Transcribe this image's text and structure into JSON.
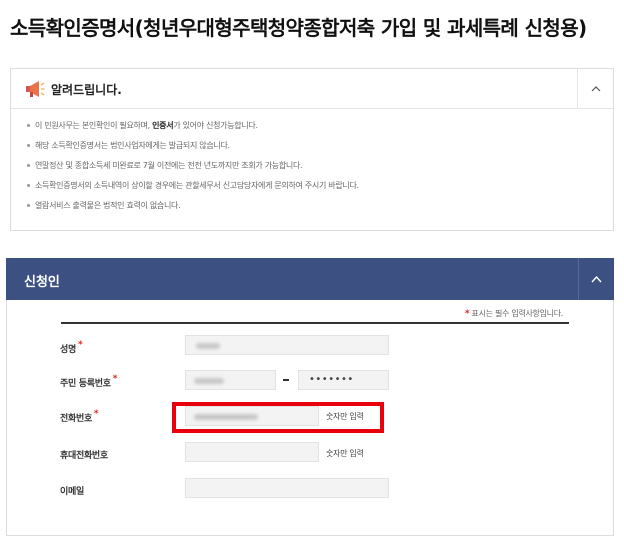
{
  "page": {
    "title": "소득확인증명서(청년우대형주택청약종합저축 가입 및 과세특례 신청용)"
  },
  "notice": {
    "title": "알려드립니다.",
    "items": [
      {
        "before": "이 민원사무는 본인확인이 필요하며, ",
        "bold": "인증서",
        "after": "가 있어야 신청가능합니다."
      },
      {
        "before": "해당 소득확인증명서는 법인사업자에게는 발급되지 않습니다.",
        "bold": "",
        "after": ""
      },
      {
        "before": "연말정산 및 종합소득세 미완료로 7월 이전에는 전전 년도까지만 조회가 가능합니다.",
        "bold": "",
        "after": ""
      },
      {
        "before": "소득확인증명서의 소득내역이 상이할 경우에는 관할세무서 신고담당자에게 문의하여 주시기 바랍니다.",
        "bold": "",
        "after": ""
      },
      {
        "before": "열람서비스 출력물은 법적인 효력이 없습니다.",
        "bold": "",
        "after": ""
      }
    ]
  },
  "applicant": {
    "title": "신청인",
    "required_note": "표시는 필수 입력사항입니다.",
    "required_mark": "*",
    "fields": {
      "name_label": "성명",
      "rrn_label": "주민 등록번호",
      "rrn_back": "•••••••",
      "phone_label": "전화번호",
      "phone_hint": "숫자만 입력",
      "mobile_label": "휴대전화번호",
      "mobile_hint": "숫자만 입력",
      "email_label": "이메일"
    }
  },
  "colors": {
    "section_header": "#3c5182",
    "highlight": "#e8000d",
    "required": "#e02020"
  }
}
